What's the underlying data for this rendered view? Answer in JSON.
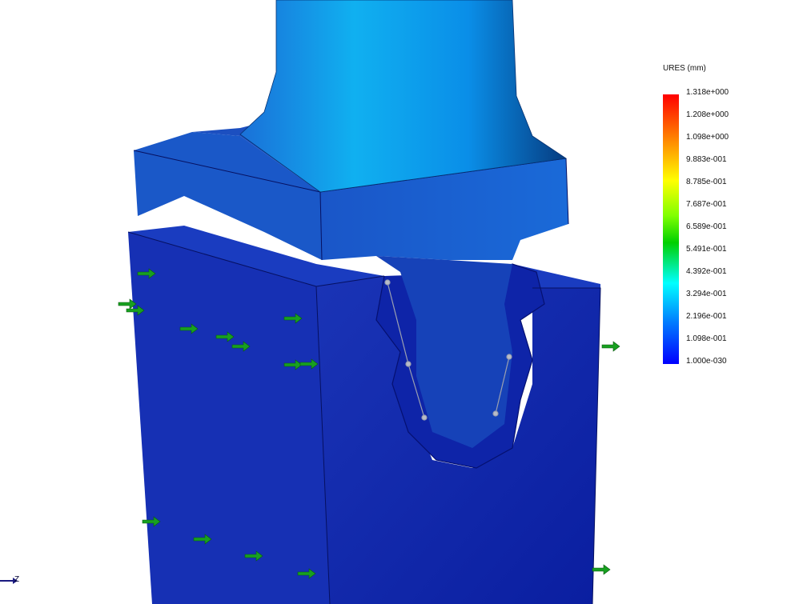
{
  "legend": {
    "title": "URES (mm)",
    "labels": [
      "1.318e+000",
      "1.208e+000",
      "1.098e+000",
      "9.883e-001",
      "8.785e-001",
      "7.687e-001",
      "6.589e-001",
      "5.491e-001",
      "4.392e-001",
      "3.294e-001",
      "2.196e-001",
      "1.098e-001",
      "1.000e-030"
    ]
  },
  "axis": {
    "z_label": "Z"
  },
  "colors": {
    "block": "#1638b8",
    "blade": "#1a8fe0",
    "load_arrow": "#18a020"
  }
}
